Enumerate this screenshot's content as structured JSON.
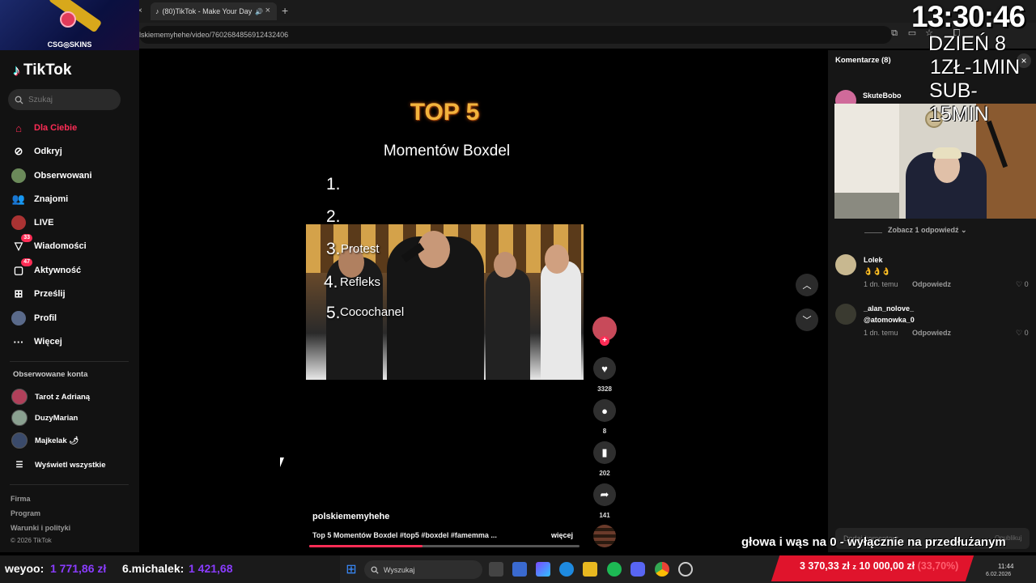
{
  "browser": {
    "tab_title": "(80)TikTok - Make Your Day",
    "url": "lskiememyhehe/video/7602684856912432406",
    "new_tab": "+",
    "close": "×"
  },
  "overlay": {
    "sponsor": "CSG◎SKINS",
    "clock": "13:30:46",
    "day": "DZIEŃ 8",
    "rate1": "1ZŁ-1MIN",
    "rate2": "SUB-15MIN",
    "ticker": "głowa i wąs na 0 - wyłącznie na przedłużanym",
    "donor1_name": "weyoo:",
    "donor1_amount": "1 771,86 zł",
    "donor2_name": "6.michalek:",
    "donor2_amount": "1 421,68",
    "goal_current": "3 370,33 zł",
    "goal_sep": "z",
    "goal_target": "10 000,00 zł",
    "goal_pct": "(33,70%)"
  },
  "sidebar": {
    "logo": "TikTok",
    "search_placeholder": "Szukaj",
    "nav": [
      {
        "label": "Dla Ciebie",
        "icon": "home-icon"
      },
      {
        "label": "Odkryj",
        "icon": "compass-icon"
      },
      {
        "label": "Obserwowani",
        "icon": "following-icon"
      },
      {
        "label": "Znajomi",
        "icon": "friends-icon"
      },
      {
        "label": "LIVE",
        "icon": "live-icon"
      },
      {
        "label": "Wiadomości",
        "icon": "messages-icon",
        "badge": "33"
      },
      {
        "label": "Aktywność",
        "icon": "activity-icon",
        "badge": "47"
      },
      {
        "label": "Prześlij",
        "icon": "upload-icon"
      },
      {
        "label": "Profil",
        "icon": "profile-icon"
      },
      {
        "label": "Więcej",
        "icon": "more-icon"
      }
    ],
    "followed_heading": "Obserwowane konta",
    "accounts": [
      {
        "name": "Tarot z Adrianą"
      },
      {
        "name": "DuzyMarian"
      },
      {
        "name": "Majkelak 🌶"
      }
    ],
    "show_all": "Wyświetl wszystkie",
    "footer": [
      "Firma",
      "Program",
      "Warunki i polityki",
      "© 2026 TikTok"
    ]
  },
  "video": {
    "title": "TOP 5",
    "subtitle": "Momentów Boxdel",
    "items": [
      "1.",
      "2.",
      "3.",
      "4.",
      "5."
    ],
    "item_labels": [
      "",
      "",
      "Protest",
      "Refleks",
      "Cocochanel"
    ],
    "author": "polskiememyhehe",
    "caption": "Top 5 Momentów Boxdel #top5 #boxdel #famemma ...",
    "more": "więcej"
  },
  "actions": {
    "likes": "3328",
    "comments": "8",
    "saves": "202",
    "shares": "141"
  },
  "comments": {
    "header": "Komentarze",
    "count": "(8)",
    "close": "×",
    "items": [
      {
        "name": "SkuteBobo"
      },
      {
        "name": "Lolek",
        "text": "👌👌👌",
        "time": "1 dn. temu",
        "reply": "Odpowiedz",
        "likes": "0"
      },
      {
        "name": "_alan_nolove_",
        "text": "@atomowka_0",
        "time": "1 dn. temu",
        "reply": "Odpowiedz",
        "likes": "0"
      }
    ],
    "see_replies": "Zobacz 1 odpowiedź",
    "input_placeholder": "Dodaj komentarz...",
    "post": "Opublikuj"
  },
  "taskbar": {
    "search_placeholder": "Wyszukaj",
    "time": "11:44",
    "date": "6.02.2026"
  },
  "colors": {
    "accent": "#fe2c55",
    "gold": "#f2b33d",
    "purple": "#8a3cff",
    "red": "#e0142c"
  }
}
